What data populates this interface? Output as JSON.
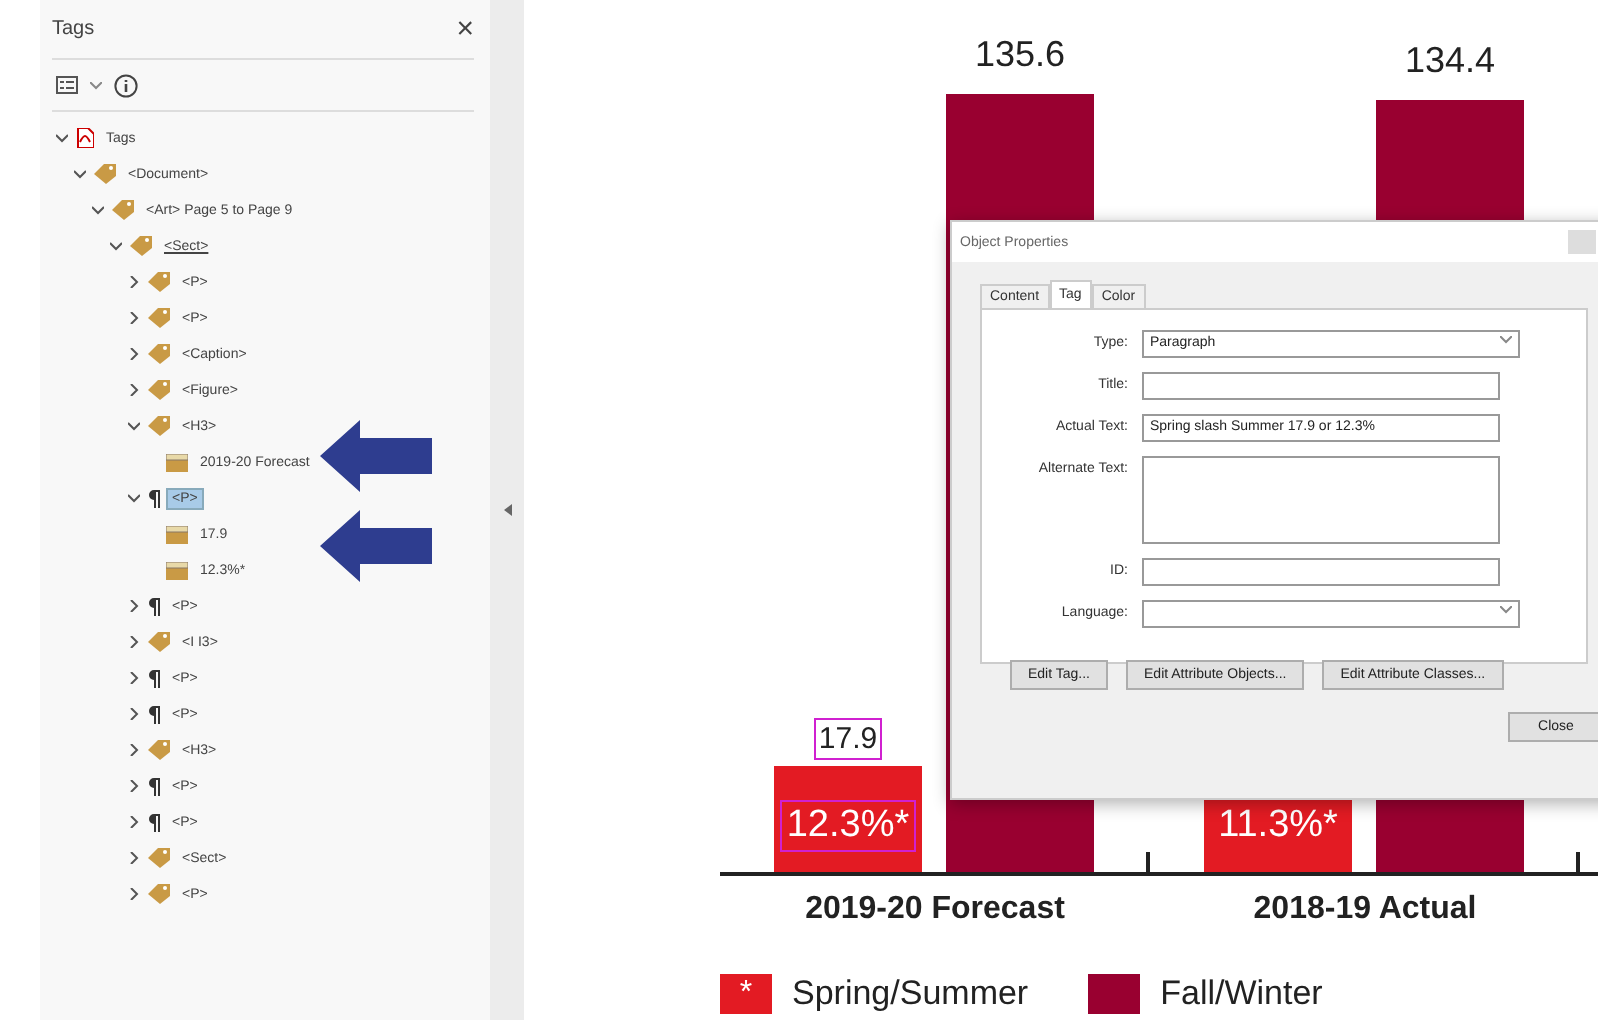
{
  "tags_panel": {
    "title": "Tags",
    "close": "×",
    "tree": [
      {
        "label": "Tags",
        "kind": "pdf",
        "expanded": true,
        "selected": false,
        "children": [
          {
            "label": "<Document>",
            "kind": "tag",
            "expanded": true,
            "selected": false,
            "children": [
              {
                "label": "<Art> Page 5 to Page 9",
                "kind": "tag",
                "expanded": true,
                "selected": false,
                "children": [
                  {
                    "label": "<Sect>",
                    "kind": "tag",
                    "expanded": true,
                    "selected": false,
                    "underlined": true,
                    "children": [
                      {
                        "label": "<P>",
                        "kind": "tag",
                        "expanded": false,
                        "selected": false
                      },
                      {
                        "label": "<P>",
                        "kind": "tag",
                        "expanded": false,
                        "selected": false
                      },
                      {
                        "label": "<Caption>",
                        "kind": "tag",
                        "expanded": false,
                        "selected": false
                      },
                      {
                        "label": "<Figure>",
                        "kind": "tag",
                        "expanded": false,
                        "selected": false
                      },
                      {
                        "label": "<H3>",
                        "kind": "tag",
                        "expanded": true,
                        "selected": false,
                        "children": [
                          {
                            "label": "2019-20 Forecast",
                            "kind": "content",
                            "selected": false
                          }
                        ]
                      },
                      {
                        "label": "<P>",
                        "kind": "para",
                        "expanded": true,
                        "selected": true,
                        "children": [
                          {
                            "label": "17.9",
                            "kind": "content",
                            "selected": false
                          },
                          {
                            "label": "12.3%*",
                            "kind": "content",
                            "selected": false
                          }
                        ]
                      },
                      {
                        "label": "<P>",
                        "kind": "para",
                        "expanded": false,
                        "selected": false
                      },
                      {
                        "label": "<I I3>",
                        "kind": "tag",
                        "expanded": false,
                        "selected": false
                      },
                      {
                        "label": "<P>",
                        "kind": "para",
                        "expanded": false,
                        "selected": false
                      },
                      {
                        "label": "<P>",
                        "kind": "para",
                        "expanded": false,
                        "selected": false
                      },
                      {
                        "label": "<H3>",
                        "kind": "tag",
                        "expanded": false,
                        "selected": false
                      },
                      {
                        "label": "<P>",
                        "kind": "para",
                        "expanded": false,
                        "selected": false
                      },
                      {
                        "label": "<P>",
                        "kind": "para",
                        "expanded": false,
                        "selected": false
                      },
                      {
                        "label": "<Sect>",
                        "kind": "tag",
                        "expanded": false,
                        "selected": false
                      },
                      {
                        "label": "<P>",
                        "kind": "tag",
                        "expanded": false,
                        "selected": false
                      }
                    ]
                  }
                ]
              }
            ]
          }
        ]
      }
    ]
  },
  "chart": {
    "groups": [
      {
        "label": "2019-20 Forecast",
        "bars": [
          {
            "text": "12.3%*",
            "above": "17.9",
            "outlined": true
          },
          {
            "above": "135.6",
            "outlined": false
          }
        ]
      },
      {
        "label": "2018-19 Actual",
        "bars": [
          {
            "text": "11.3%*",
            "outlined": false
          },
          {
            "above": "134.4",
            "outlined": false
          }
        ]
      }
    ],
    "legend": [
      {
        "name": "Spring/Summer",
        "color": "#e31b23",
        "symbol": "*"
      },
      {
        "name": "Fall/Winter",
        "color": "#990030"
      }
    ]
  },
  "dialog": {
    "title": "Object Properties",
    "tabs": [
      {
        "label": "Content",
        "selected": false
      },
      {
        "label": "Tag",
        "selected": true
      },
      {
        "label": "Color",
        "selected": false
      }
    ],
    "fields": [
      {
        "label": "Type:",
        "kind": "select",
        "value": "Paragraph"
      },
      {
        "label": "Title:",
        "kind": "text"
      },
      {
        "label": "Actual Text:",
        "kind": "text",
        "value": "Spring slash Summer 17.9 or 12.3%"
      },
      {
        "label": "Alternate Text:",
        "kind": "area"
      },
      {
        "label": "ID:",
        "kind": "text"
      },
      {
        "label": "Language:",
        "kind": "select"
      }
    ],
    "buttons": [
      "Edit Tag...",
      "Edit Attribute Objects...",
      "Edit Attribute Classes..."
    ],
    "close": "Close"
  }
}
